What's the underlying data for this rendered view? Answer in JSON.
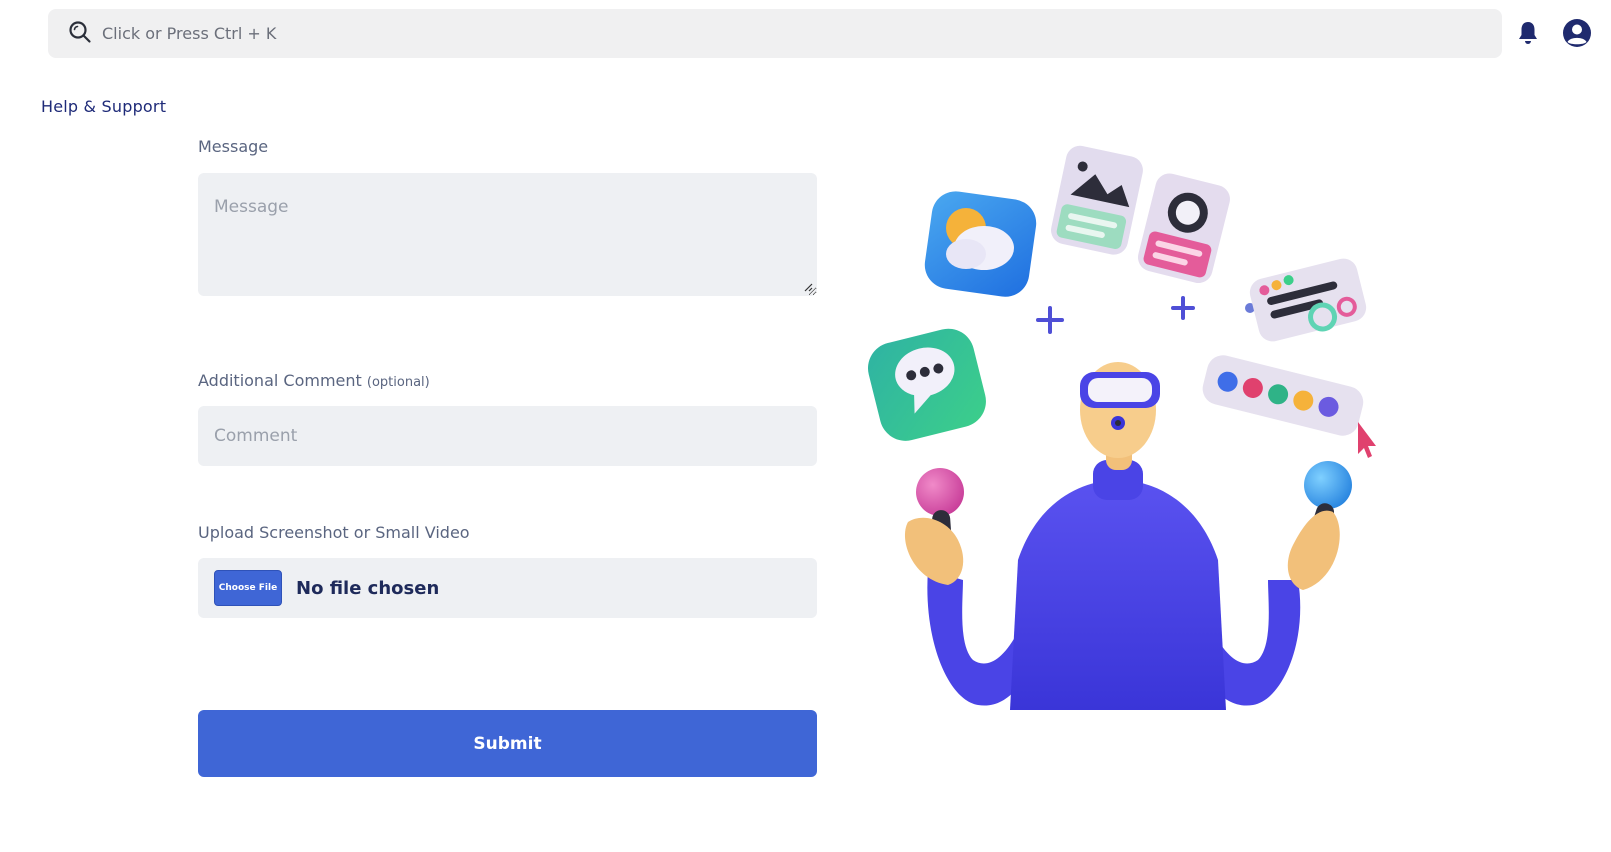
{
  "header": {
    "search_placeholder": "Click or Press Ctrl + K",
    "icons": {
      "search": "search-icon",
      "notifications": "bell-icon",
      "account": "user-circle-icon"
    }
  },
  "page": {
    "title": "Help & Support"
  },
  "form": {
    "message": {
      "label": "Message",
      "placeholder": "Message",
      "value": ""
    },
    "comment": {
      "label": "Additional Comment",
      "optional_tag": "(optional)",
      "placeholder": "Comment",
      "value": ""
    },
    "upload": {
      "label": "Upload Screenshot or Small Video",
      "button_label": "Choose File",
      "status": "No file chosen"
    },
    "submit_label": "Submit"
  },
  "colors": {
    "accent": "#3f66d6",
    "field_bg": "#eef0f3",
    "search_bg": "#f0f0f1",
    "title": "#1e2a78"
  }
}
